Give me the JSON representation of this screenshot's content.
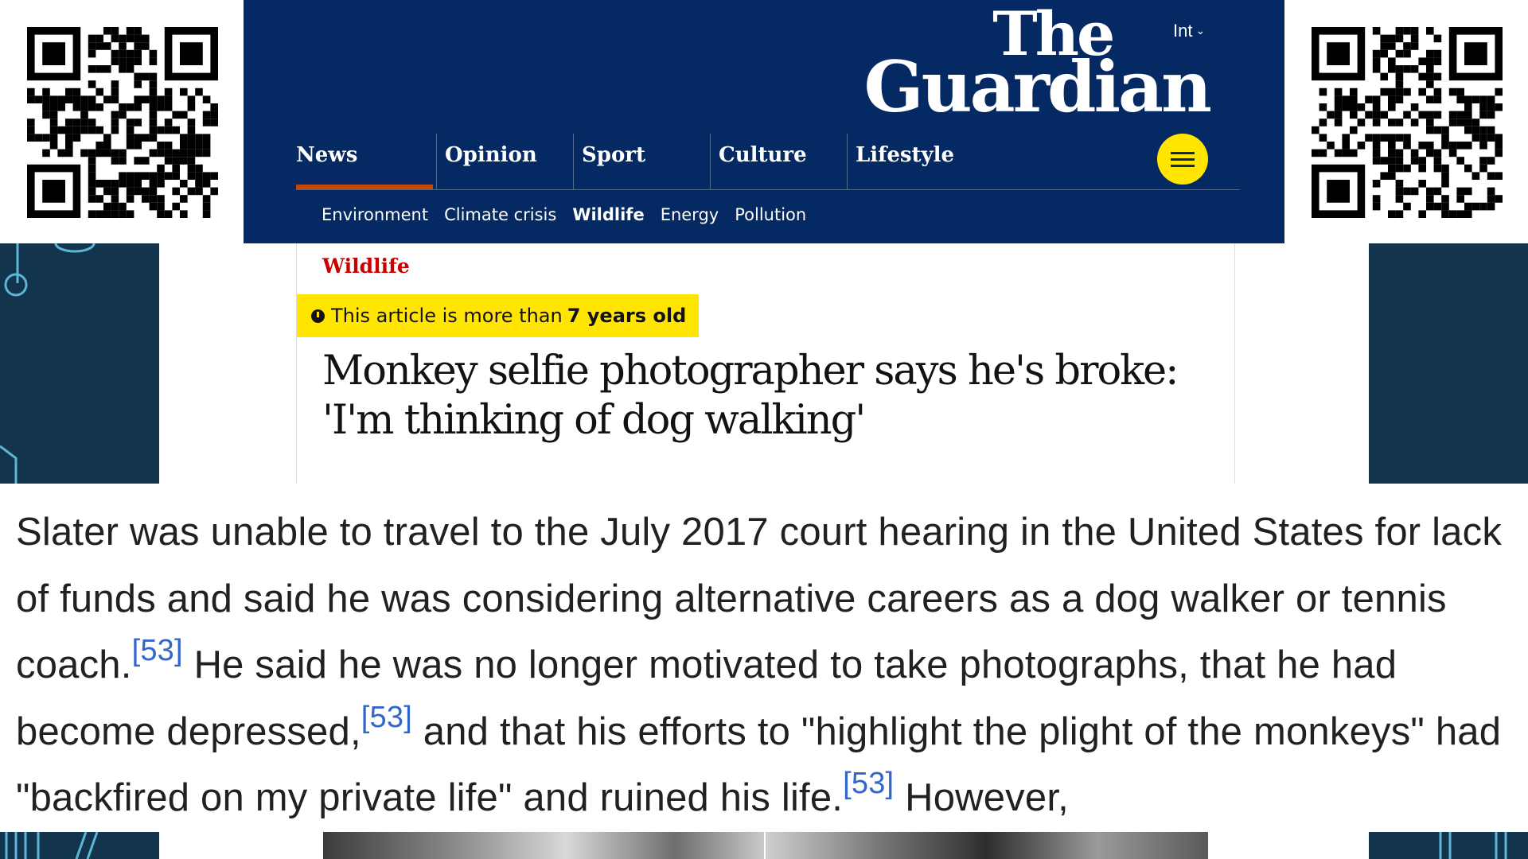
{
  "header": {
    "edition": "Int",
    "logo_line1": "The",
    "logo_line2": "Guardian",
    "pillars": [
      {
        "label": "News",
        "active": true
      },
      {
        "label": "Opinion",
        "active": false
      },
      {
        "label": "Sport",
        "active": false
      },
      {
        "label": "Culture",
        "active": false
      },
      {
        "label": "Lifestyle",
        "active": false
      }
    ],
    "subnav": [
      "Environment",
      "Climate crisis",
      "Wildlife",
      "Energy",
      "Pollution"
    ],
    "subnav_current": "Wildlife"
  },
  "article": {
    "section": "Wildlife",
    "age_notice_prefix": "This article is more than",
    "age_notice_bold": "7 years old",
    "headline": "Monkey selfie photographer says he's broke: 'I'm thinking of dog walking'"
  },
  "excerpt": {
    "part1": "Slater was unable to travel to the July 2017 court hearing in the United States for lack of funds and said he was considering alternative careers as a dog walker or tennis coach.",
    "ref1": "[53]",
    "part2": " He said he was no longer motivated to take photographs, that he had become depressed,",
    "ref2": "[53]",
    "part3": " and that his efforts to \"highlight the plight of the monkeys\" had \"backfired on my private life\" and ruined his life.",
    "ref3": "[53]",
    "part4": " However,"
  },
  "colors": {
    "guardian_navy": "#052962",
    "guardian_yellow": "#ffe500",
    "section_red": "#c70000",
    "active_underline": "#c74600",
    "wiki_link": "#3366cc",
    "side_panel": "#13344d"
  },
  "icons": [
    "qr-code-icon",
    "clock-icon",
    "menu-icon",
    "chevron-down-icon"
  ]
}
